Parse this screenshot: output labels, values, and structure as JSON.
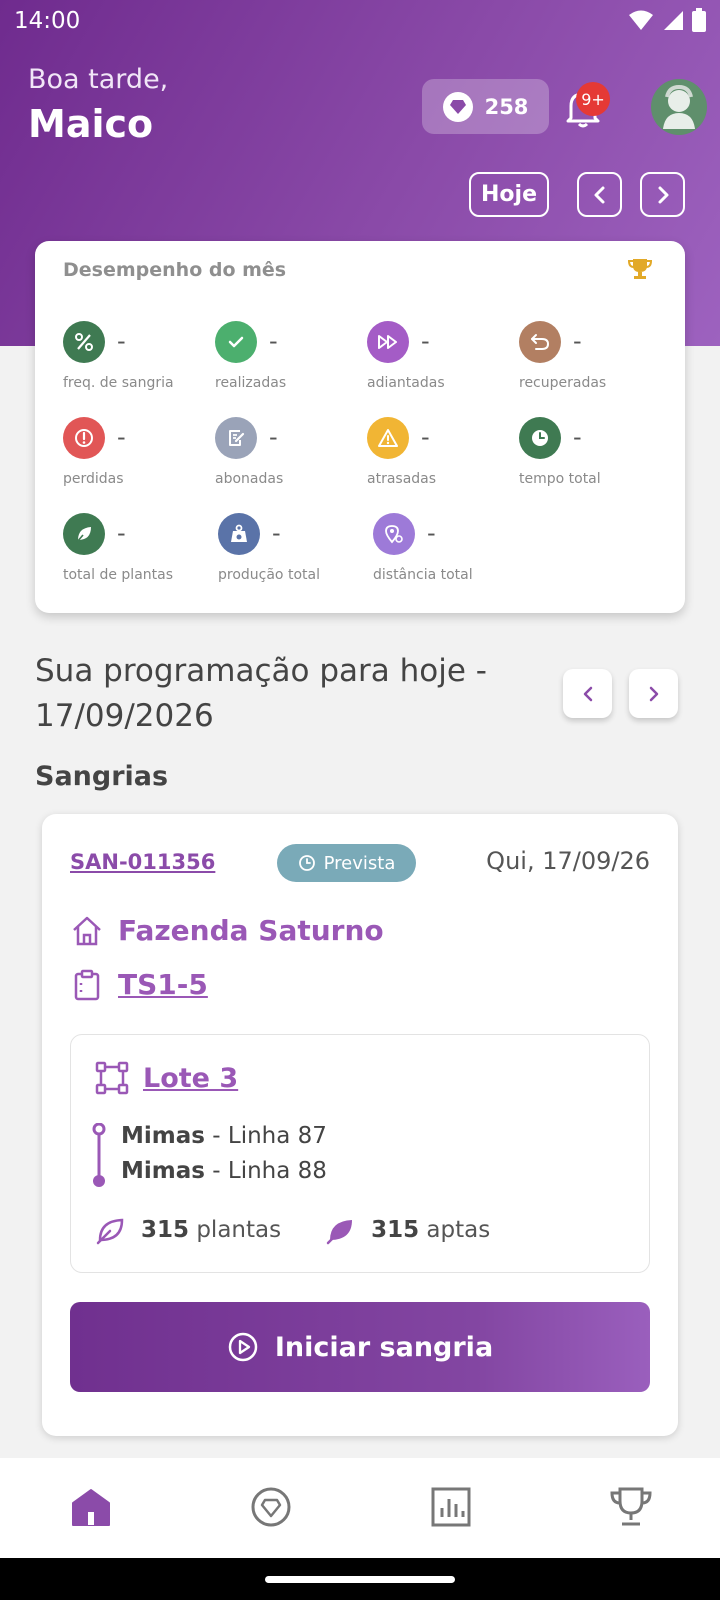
{
  "status_bar": {
    "time": "14:00"
  },
  "header": {
    "greeting": "Boa tarde,",
    "user_name": "Maico",
    "points": "258",
    "notifications_badge": "9+",
    "today_button": "Hoje"
  },
  "performance": {
    "title": "Desempenho do mês",
    "metrics": [
      {
        "label": "freq. de sangria",
        "value": "-",
        "icon": "percent-icon",
        "color": "#3f7a52"
      },
      {
        "label": "realizadas",
        "value": "-",
        "icon": "check-icon",
        "color": "#4caf6e"
      },
      {
        "label": "adiantadas",
        "value": "-",
        "icon": "fast-forward-icon",
        "color": "#a45cc6"
      },
      {
        "label": "recuperadas",
        "value": "-",
        "icon": "undo-icon",
        "color": "#b27f62"
      },
      {
        "label": "perdidas",
        "value": "-",
        "icon": "alert-circle-icon",
        "color": "#e15656"
      },
      {
        "label": "abonadas",
        "value": "-",
        "icon": "edit-note-icon",
        "color": "#9aa3b8"
      },
      {
        "label": "atrasadas",
        "value": "-",
        "icon": "warning-icon",
        "color": "#f1b534"
      },
      {
        "label": "tempo total",
        "value": "-",
        "icon": "clock-icon",
        "color": "#3f7a52"
      },
      {
        "label": "total de plantas",
        "value": "-",
        "icon": "leaf-icon",
        "color": "#3f7a52"
      },
      {
        "label": "produção total",
        "value": "-",
        "icon": "weight-icon",
        "color": "#5a73a8"
      },
      {
        "label": "distância total",
        "value": "-",
        "icon": "map-pin-icon",
        "color": "#9d7ad8"
      }
    ]
  },
  "schedule": {
    "title_line1": "Sua programação para hoje -",
    "title_line2": "17/09/2026",
    "section": "Sangrias"
  },
  "tapping_card": {
    "code": "SAN-011356",
    "status": "Prevista",
    "date": "Qui, 17/09/26",
    "farm": "Fazenda Saturno",
    "group": "TS1-5",
    "lot": "Lote 3",
    "lines": [
      {
        "name": "Mimas",
        "line": " - Linha 87"
      },
      {
        "name": "Mimas",
        "line": " - Linha 88"
      }
    ],
    "plants_count": "315",
    "plants_label": " plantas",
    "apt_count": "315",
    "apt_label": " aptas",
    "start_button": "Iniciar sangria"
  },
  "bottom_nav": [
    "home-icon",
    "gem-icon",
    "chart-icon",
    "trophy-icon"
  ]
}
